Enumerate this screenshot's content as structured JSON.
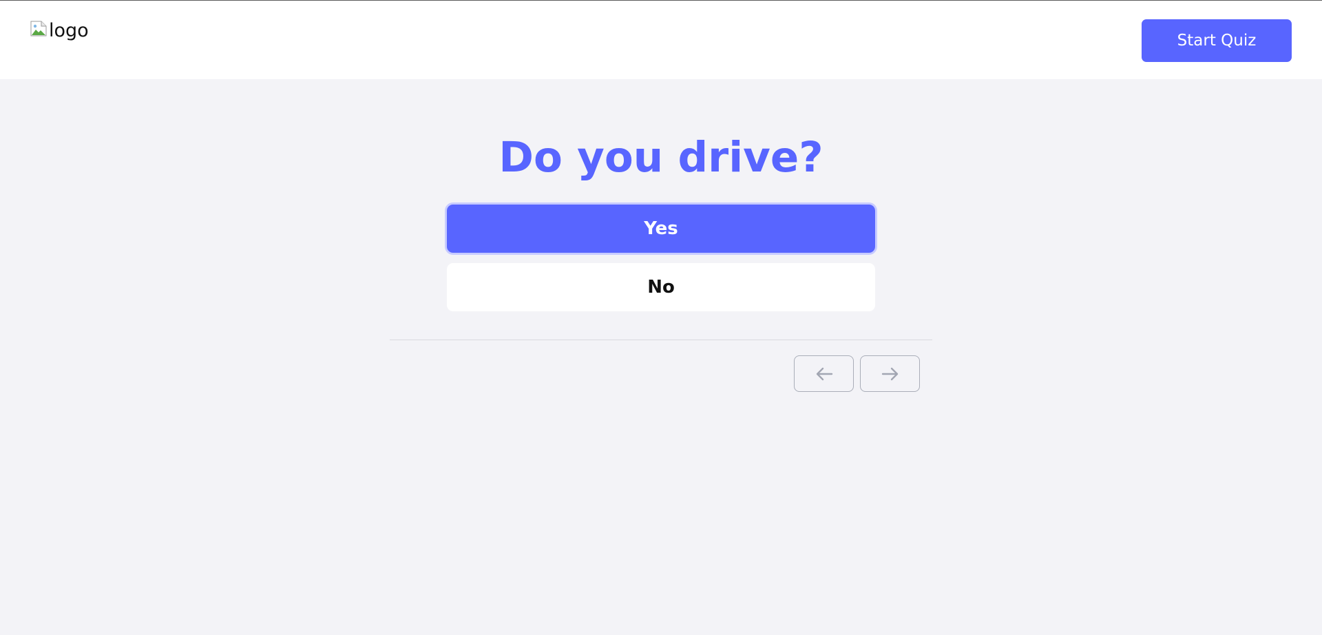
{
  "header": {
    "logo_alt": "logo",
    "start_button_label": "Start Quiz"
  },
  "quiz": {
    "question": "Do you drive?",
    "options": [
      {
        "label": "Yes",
        "selected": true
      },
      {
        "label": "No",
        "selected": false
      }
    ]
  },
  "navigation": {
    "prev_icon": "arrow-left-icon",
    "next_icon": "arrow-right-icon"
  },
  "colors": {
    "accent": "#5865ff",
    "background": "#f3f3f7",
    "header_bg": "#ffffff"
  }
}
